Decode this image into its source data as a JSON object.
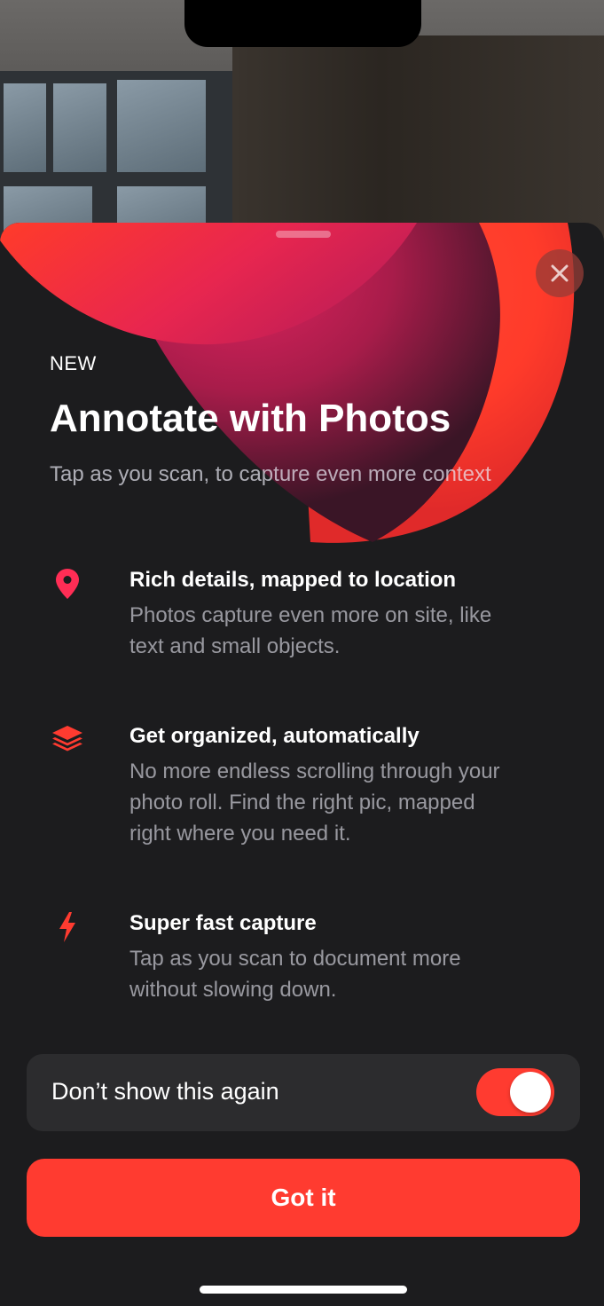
{
  "onboarding": {
    "eyebrow": "NEW",
    "title": "Annotate with Photos",
    "subtitle": "Tap as you scan, to capture even more context",
    "close_icon": "close-icon",
    "features": [
      {
        "icon": "location-pin-icon",
        "title": "Rich details, mapped to location",
        "description": "Photos capture even more on site, like text and small objects."
      },
      {
        "icon": "layers-icon",
        "title": "Get organized, automatically",
        "description": "No more endless scrolling through your photo roll. Find the right pic, mapped right where you need it."
      },
      {
        "icon": "lightning-bolt-icon",
        "title": "Super fast capture",
        "description": "Tap as you scan to document more without slowing down."
      }
    ],
    "toggle": {
      "label": "Don’t show this again",
      "enabled": true
    },
    "primary_button": "Got it"
  },
  "colors": {
    "accent": "#ff3b30",
    "sheet_background": "#1c1c1e",
    "row_background": "#2c2c2e"
  }
}
